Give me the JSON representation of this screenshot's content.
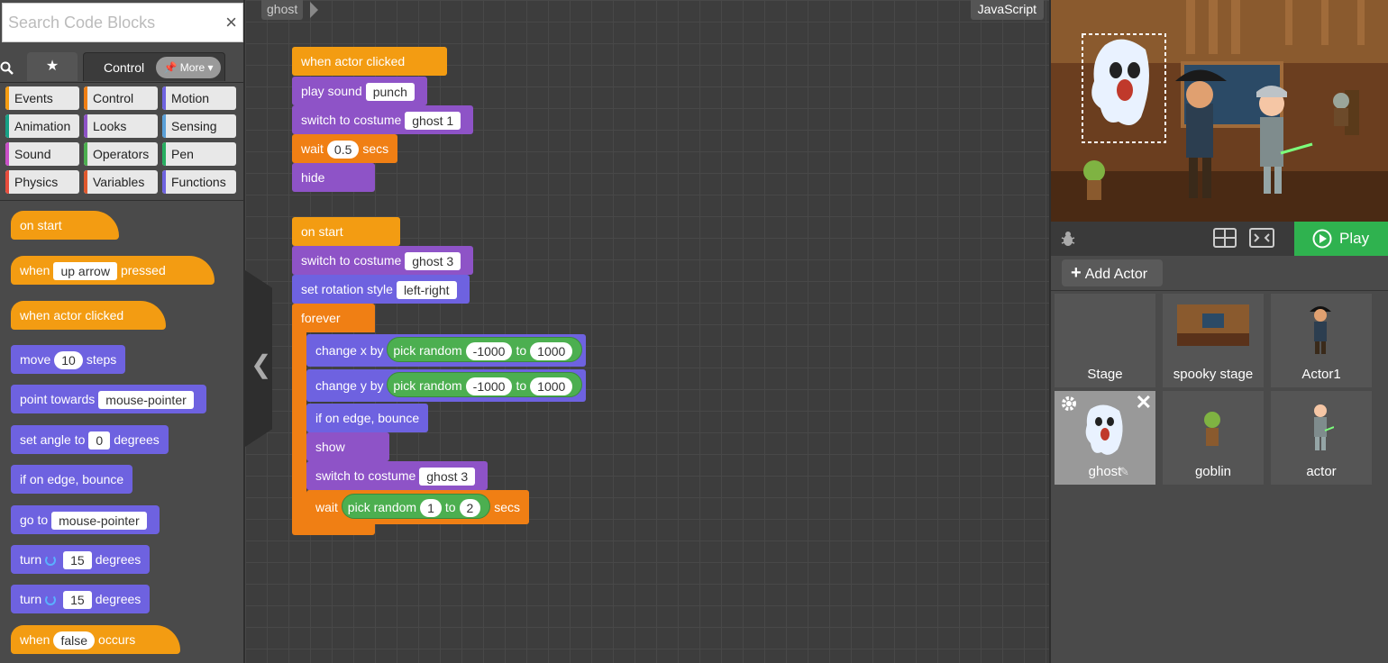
{
  "palette": {
    "search_placeholder": "Search Code Blocks",
    "clear_icon": "×",
    "tabs": {
      "star": "★",
      "control_label": "Control",
      "more_label": "📌 More ▾"
    },
    "categories": [
      {
        "label": "Events",
        "color": "#f39c12"
      },
      {
        "label": "Control",
        "color": "#f07f14"
      },
      {
        "label": "Motion",
        "color": "#6e62e0"
      },
      {
        "label": "Animation",
        "color": "#16a085"
      },
      {
        "label": "Looks",
        "color": "#8e53c7"
      },
      {
        "label": "Sensing",
        "color": "#5aa0d8"
      },
      {
        "label": "Sound",
        "color": "#c94fc7"
      },
      {
        "label": "Operators",
        "color": "#4caf50"
      },
      {
        "label": "Pen",
        "color": "#27ae60"
      },
      {
        "label": "Physics",
        "color": "#e74c3c"
      },
      {
        "label": "Variables",
        "color": "#e0582d"
      },
      {
        "label": "Functions",
        "color": "#6e62e0"
      }
    ],
    "blocks": {
      "on_start": "on start",
      "when_key_pre": "when",
      "when_key_slot": "up arrow",
      "when_key_post": "pressed",
      "when_actor_clicked": "when actor clicked",
      "move_pre": "move",
      "move_slot": "10",
      "move_post": "steps",
      "point_pre": "point towards",
      "point_slot": "mouse-pointer",
      "angle_pre": "set angle to",
      "angle_slot": "0",
      "angle_post": "degrees",
      "edge_bounce": "if on edge, bounce",
      "goto_pre": "go to",
      "goto_slot": "mouse-pointer",
      "turn1_pre": "turn",
      "turn1_slot": "15",
      "turn1_post": "degrees",
      "turn2_pre": "turn",
      "turn2_slot": "15",
      "turn2_post": "degrees",
      "when_occ_pre": "when",
      "when_occ_slot": "false",
      "when_occ_post": "occurs"
    }
  },
  "workspace": {
    "breadcrumb": "ghost",
    "code_toggle": "JavaScript",
    "script1": {
      "hat": "when actor clicked",
      "play_sound": "play sound",
      "play_sound_slot": "punch",
      "switch_costume": "switch to costume",
      "switch_costume_slot": "ghost 1",
      "wait": "wait",
      "wait_slot": "0.5",
      "wait_post": "secs",
      "hide": "hide"
    },
    "script2": {
      "hat": "on start",
      "switch_costume": "switch to costume",
      "switch_costume_slot": "ghost 3",
      "rotation": "set rotation style",
      "rotation_slot": "left-right",
      "forever": "forever",
      "cx": "change x by",
      "cy": "change y by",
      "pick_random": "pick random",
      "to": "to",
      "rand_min": "-1000",
      "rand_max": "1000",
      "edge_bounce": "if on edge, bounce",
      "show": "show",
      "switch_costume2": "switch to costume",
      "switch_costume2_slot": "ghost 3",
      "wait": "wait",
      "wait_min": "1",
      "wait_max": "2",
      "wait_post": "secs"
    }
  },
  "right": {
    "play_label": "Play",
    "add_actor_label": "Add Actor",
    "actors": [
      {
        "name": "Stage"
      },
      {
        "name": "spooky stage"
      },
      {
        "name": "Actor1"
      },
      {
        "name": "ghost"
      },
      {
        "name": "goblin"
      },
      {
        "name": "actor"
      }
    ]
  }
}
